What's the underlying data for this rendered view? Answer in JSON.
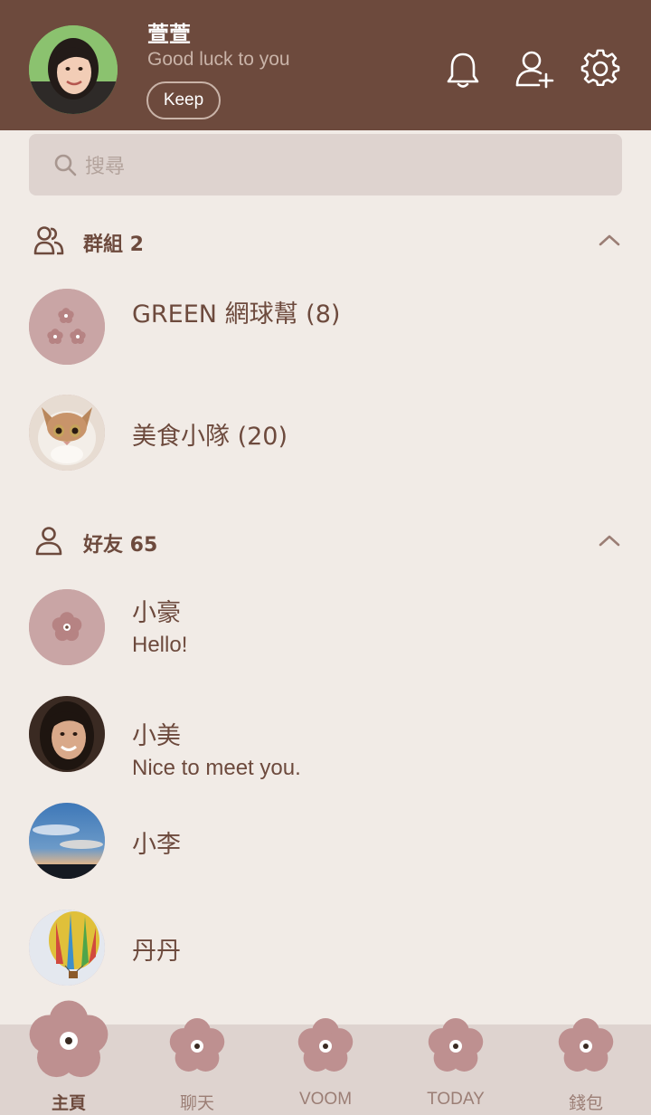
{
  "profile": {
    "name": "萱萱",
    "status": "Good luck to you",
    "keep_label": "Keep"
  },
  "header_icons": [
    "bell-icon",
    "add-friend-icon",
    "gear-icon"
  ],
  "search": {
    "placeholder": "搜尋"
  },
  "groups": {
    "title": "群組 2",
    "items": [
      {
        "name": "GREEN 網球幫 (8)"
      },
      {
        "name": "美食小隊 (20)"
      }
    ]
  },
  "friends": {
    "title": "好友 65",
    "items": [
      {
        "name": "小豪",
        "status": "Hello!"
      },
      {
        "name": "小美",
        "status": "Nice to meet you."
      },
      {
        "name": "小李",
        "status": ""
      },
      {
        "name": "丹丹",
        "status": ""
      }
    ]
  },
  "nav": {
    "items": [
      {
        "label": "主頁",
        "active": true
      },
      {
        "label": "聊天"
      },
      {
        "label": "VOOM"
      },
      {
        "label": "TODAY"
      },
      {
        "label": "錢包"
      }
    ]
  },
  "colors": {
    "header_bg": "#6D4A3D",
    "page_bg": "#F1EBE6",
    "accent_flower": "#C09595",
    "nav_bg": "#DED3CF"
  }
}
